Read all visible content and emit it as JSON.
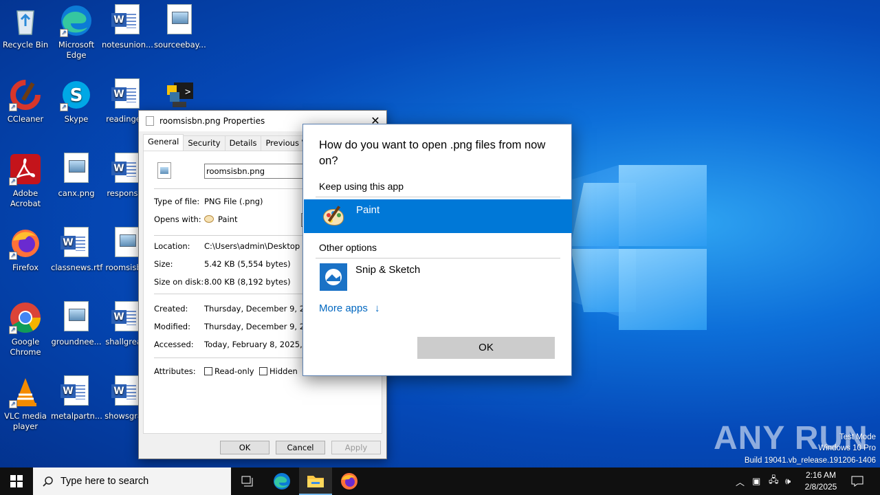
{
  "desktop": {
    "icons": [
      {
        "label": "Recycle Bin",
        "icon": "recycle-bin-icon"
      },
      {
        "label": "Microsoft Edge",
        "icon": "edge-icon"
      },
      {
        "label": "notesunion...",
        "icon": "word-doc-icon"
      },
      {
        "label": "sourceebay...",
        "icon": "image-file-icon"
      },
      {
        "label": "CCleaner",
        "icon": "ccleaner-icon"
      },
      {
        "label": "Skype",
        "icon": "skype-icon"
      },
      {
        "label": "readinge...",
        "icon": "word-doc-icon"
      },
      {
        "label": "",
        "icon": "python-icon"
      },
      {
        "label": "Adobe Acrobat",
        "icon": "acrobat-icon"
      },
      {
        "label": "canx.png",
        "icon": "image-file-icon"
      },
      {
        "label": "responsi...",
        "icon": "word-doc-icon"
      },
      {
        "label": "Firefox",
        "icon": "firefox-icon"
      },
      {
        "label": "classnews.rtf",
        "icon": "word-doc-icon"
      },
      {
        "label": "roomsisb...",
        "icon": "image-file-icon"
      },
      {
        "label": "Google Chrome",
        "icon": "chrome-icon"
      },
      {
        "label": "groundnee...",
        "icon": "image-file-icon"
      },
      {
        "label": "shallgrea...",
        "icon": "word-doc-icon"
      },
      {
        "label": "VLC media player",
        "icon": "vlc-icon"
      },
      {
        "label": "metalpartn...",
        "icon": "word-doc-icon"
      },
      {
        "label": "showsgra...",
        "icon": "word-doc-icon"
      }
    ]
  },
  "properties": {
    "title": "roomsisbn.png Properties",
    "tabs": [
      "General",
      "Security",
      "Details",
      "Previous Versions"
    ],
    "filename": "roomsisbn.png",
    "type_label": "Type of file:",
    "type_value": "PNG File (.png)",
    "opens_label": "Opens with:",
    "opens_value": "Paint",
    "location_label": "Location:",
    "location_value": "C:\\Users\\admin\\Desktop",
    "size_label": "Size:",
    "size_value": "5.42 KB (5,554 bytes)",
    "sizedisk_label": "Size on disk:",
    "sizedisk_value": "8.00 KB (8,192 bytes)",
    "created_label": "Created:",
    "created_value": "Thursday, December 9, 2021,",
    "modified_label": "Modified:",
    "modified_value": "Thursday, December 9, 2021,",
    "accessed_label": "Accessed:",
    "accessed_value": "Today, February 8, 2025, 2:16",
    "attributes_label": "Attributes:",
    "readonly_label": "Read-only",
    "hidden_label": "Hidden",
    "ok": "OK",
    "cancel": "Cancel",
    "apply": "Apply"
  },
  "openwith": {
    "question": "How do you want to open .png files from now on?",
    "keep_label": "Keep using this app",
    "selected_app": "Paint",
    "other_label": "Other options",
    "other_app": "Snip & Sketch",
    "more_apps": "More apps",
    "ok": "OK"
  },
  "watermark": {
    "brand": "ANY RUN",
    "mode": "Test Mode",
    "edition": "Windows 10 Pro",
    "build": "Build 19041.vb_release.191206-1406"
  },
  "taskbar": {
    "search_placeholder": "Type here to search",
    "time": "2:16 AM",
    "date": "2/8/2025"
  },
  "colors": {
    "accent": "#0078d7",
    "link": "#0067c0",
    "taskbar": "#101010"
  }
}
